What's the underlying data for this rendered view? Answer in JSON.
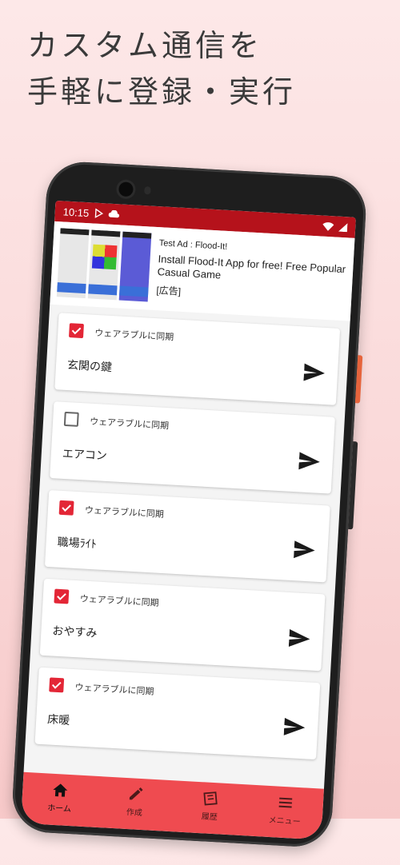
{
  "headline": {
    "line1": "カスタム通信を",
    "line2": "手軽に登録・実行"
  },
  "status_bar": {
    "time": "10:15"
  },
  "ad": {
    "label": "Test Ad : Flood-It!",
    "headline": "Install Flood-It App for free! Free Popular Casual Game",
    "tag": "[広告]"
  },
  "commands": [
    {
      "sync_label": "ウェアラブルに同期",
      "synced": true,
      "name": "玄関の鍵"
    },
    {
      "sync_label": "ウェアラブルに同期",
      "synced": false,
      "name": "エアコン"
    },
    {
      "sync_label": "ウェアラブルに同期",
      "synced": true,
      "name": "職場ﾗｲﾄ"
    },
    {
      "sync_label": "ウェアラブルに同期",
      "synced": true,
      "name": "おやすみ"
    },
    {
      "sync_label": "ウェアラブルに同期",
      "synced": true,
      "name": "床暖"
    }
  ],
  "bottom_nav": [
    {
      "label": "ホーム",
      "icon": "home-icon",
      "active": true
    },
    {
      "label": "作成",
      "icon": "pencil-icon",
      "active": false
    },
    {
      "label": "履歴",
      "icon": "history-icon",
      "active": false
    },
    {
      "label": "メニュー",
      "icon": "menu-icon",
      "active": false
    }
  ],
  "colors": {
    "accent": "#e32636",
    "status_bar": "#b5121b",
    "nav": "#ef4b50"
  }
}
